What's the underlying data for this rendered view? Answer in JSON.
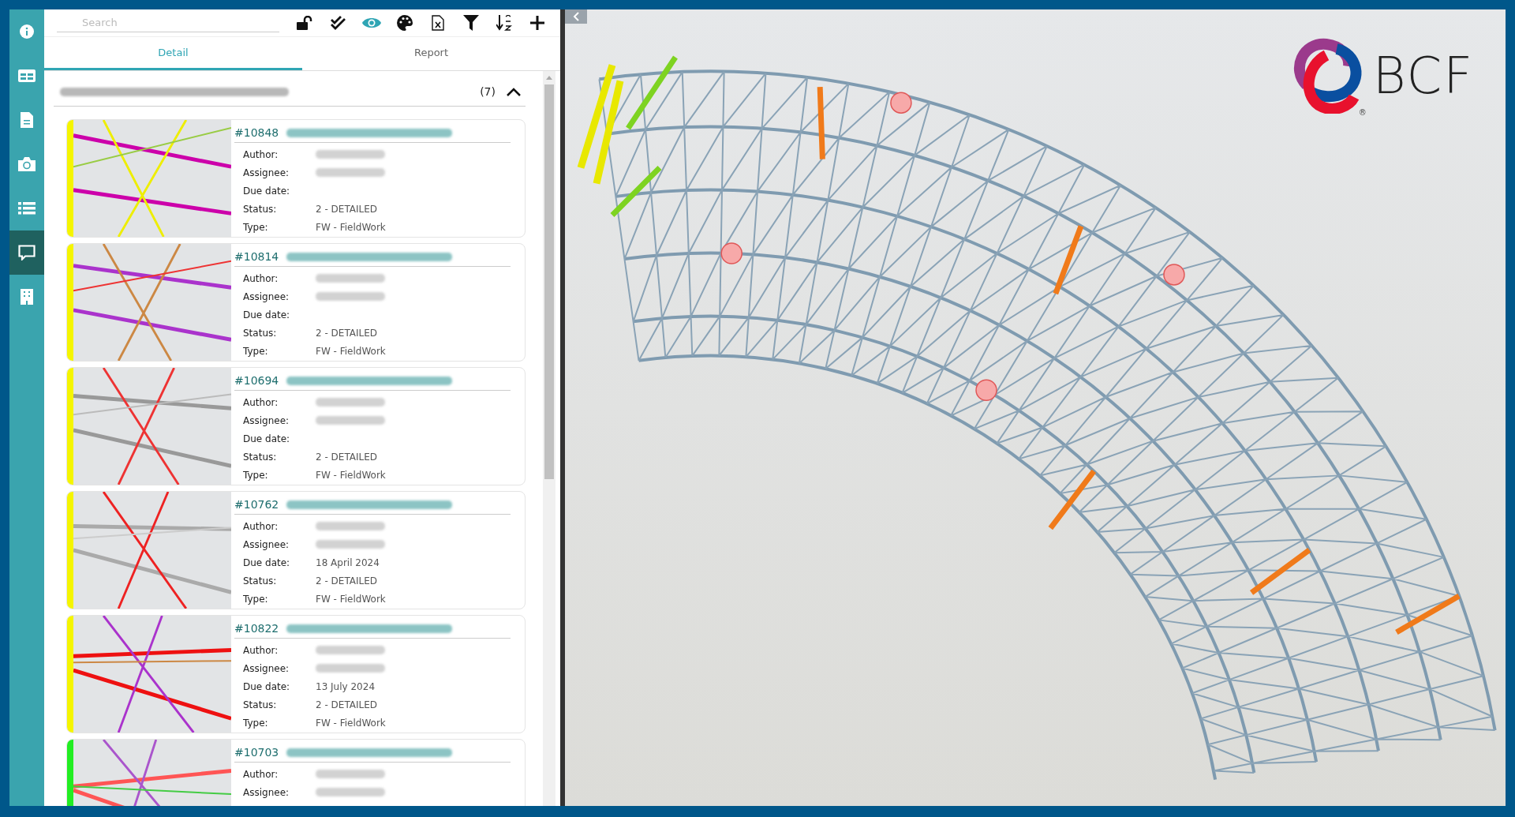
{
  "sidebar": {
    "items": [
      {
        "kind": "info",
        "selected": false
      },
      {
        "kind": "table",
        "selected": false
      },
      {
        "kind": "document",
        "selected": false
      },
      {
        "kind": "camera",
        "selected": false
      },
      {
        "kind": "list",
        "selected": false
      },
      {
        "kind": "comment",
        "selected": true
      },
      {
        "kind": "building",
        "selected": false
      }
    ]
  },
  "toolbar": {
    "search": {
      "placeholder": "Search"
    },
    "tools": [
      {
        "kind": "lock",
        "on": false
      },
      {
        "kind": "check",
        "on": false
      },
      {
        "kind": "eye",
        "on": true
      },
      {
        "kind": "palette",
        "on": false
      },
      {
        "kind": "excel",
        "on": false
      },
      {
        "kind": "filter",
        "on": false
      },
      {
        "kind": "sort",
        "on": false
      },
      {
        "kind": "add",
        "on": false
      }
    ]
  },
  "tabs": [
    {
      "label": "Detail",
      "selected": true
    },
    {
      "label": "Report",
      "selected": false
    }
  ],
  "group": {
    "count": "(7)",
    "expanded": true
  },
  "issues": [
    {
      "number": "#10848",
      "color": "#f5f500",
      "fields": [
        {
          "label": "Author:",
          "kind": "redacted"
        },
        {
          "label": "Assignee:",
          "kind": "redacted"
        },
        {
          "label": "Due date:",
          "kind": "empty"
        },
        {
          "label": "Status:",
          "kind": "text",
          "value": "2 - DETAILED"
        },
        {
          "label": "Type:",
          "kind": "text",
          "value": "FW - FieldWork"
        }
      ]
    },
    {
      "number": "#10814",
      "color": "#f5f500",
      "fields": [
        {
          "label": "Author:",
          "kind": "redacted"
        },
        {
          "label": "Assignee:",
          "kind": "redacted"
        },
        {
          "label": "Due date:",
          "kind": "empty"
        },
        {
          "label": "Status:",
          "kind": "text",
          "value": "2 - DETAILED"
        },
        {
          "label": "Type:",
          "kind": "text",
          "value": "FW - FieldWork"
        }
      ]
    },
    {
      "number": "#10694",
      "color": "#f5f500",
      "fields": [
        {
          "label": "Author:",
          "kind": "redacted"
        },
        {
          "label": "Assignee:",
          "kind": "redacted"
        },
        {
          "label": "Due date:",
          "kind": "empty"
        },
        {
          "label": "Status:",
          "kind": "text",
          "value": "2 - DETAILED"
        },
        {
          "label": "Type:",
          "kind": "text",
          "value": "FW - FieldWork"
        }
      ]
    },
    {
      "number": "#10762",
      "color": "#f5f500",
      "fields": [
        {
          "label": "Author:",
          "kind": "redacted"
        },
        {
          "label": "Assignee:",
          "kind": "redacted"
        },
        {
          "label": "Due date:",
          "kind": "text",
          "value": "18 April 2024"
        },
        {
          "label": "Status:",
          "kind": "text",
          "value": "2 - DETAILED"
        },
        {
          "label": "Type:",
          "kind": "text",
          "value": "FW - FieldWork"
        }
      ]
    },
    {
      "number": "#10822",
      "color": "#f5f500",
      "fields": [
        {
          "label": "Author:",
          "kind": "redacted"
        },
        {
          "label": "Assignee:",
          "kind": "redacted"
        },
        {
          "label": "Due date:",
          "kind": "text",
          "value": "13 July 2024"
        },
        {
          "label": "Status:",
          "kind": "text",
          "value": "2 - DETAILED"
        },
        {
          "label": "Type:",
          "kind": "text",
          "value": "FW - FieldWork"
        }
      ]
    },
    {
      "number": "#10703",
      "color": "#22ee22",
      "fields": [
        {
          "label": "Author:",
          "kind": "redacted"
        },
        {
          "label": "Assignee:",
          "kind": "redacted"
        }
      ]
    }
  ],
  "viewer": {
    "logo": {
      "text": "BCF",
      "mark": "®"
    }
  }
}
